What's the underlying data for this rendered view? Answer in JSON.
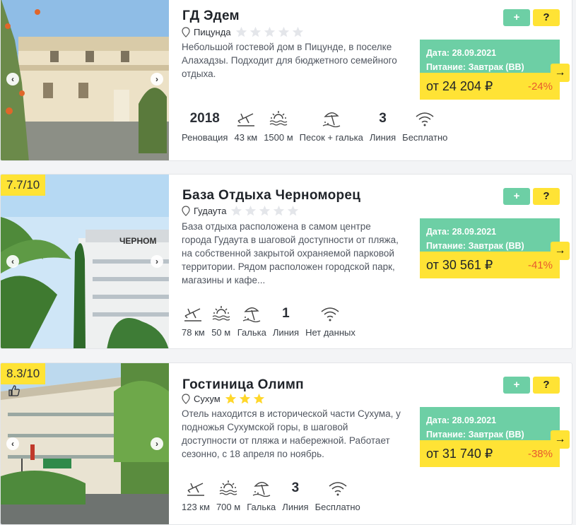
{
  "colors": {
    "accent_green": "#6dcfa5",
    "accent_yellow": "#ffe335",
    "discount": "#e85a2e",
    "star_filled": "#ffd72b",
    "star_empty": "#e4e6ea"
  },
  "ui": {
    "add_label": "+",
    "info_label": "?",
    "prev_label": "‹",
    "next_label": "›",
    "arrow_label": "→"
  },
  "hotels": [
    {
      "name": "ГД Эдем",
      "city": "Пицунда",
      "stars_filled": 0,
      "stars_total": 5,
      "rating": "",
      "description": "Небольшой гостевой дом в Пицунде, в поселке Алахадзы. Подходит для бюджетного семейного отдыха.",
      "date": "Дата: 28.09.2021",
      "meal": "Питание: Завтрак (BB)",
      "price": "от 24 204 ₽",
      "discount": "-24%",
      "features": [
        {
          "type": "text",
          "value": "2018",
          "label": "Реновация"
        },
        {
          "type": "icon",
          "icon": "airplane-icon",
          "label": "43 км"
        },
        {
          "type": "icon",
          "icon": "sea-icon",
          "label": "1500 м"
        },
        {
          "type": "icon",
          "icon": "beach-icon",
          "label": "Песок + галька"
        },
        {
          "type": "text",
          "value": "3",
          "label": "Линия"
        },
        {
          "type": "icon",
          "icon": "wifi-icon",
          "label": "Бесплатно"
        }
      ]
    },
    {
      "name": "База Отдыха Черноморец",
      "city": "Гудаута",
      "stars_filled": 0,
      "stars_total": 5,
      "rating": "7.7/10",
      "description": "База отдыха расположена в самом центре города Гудаута в шаговой доступности от пляжа, на собственной закрытой охраняемой парковой территории. Рядом расположен городской парк, магазины и кафе...",
      "date": "Дата: 28.09.2021",
      "meal": "Питание: Завтрак (BB)",
      "price": "от 30 561 ₽",
      "discount": "-41%",
      "features": [
        {
          "type": "icon",
          "icon": "airplane-icon",
          "label": "78 км"
        },
        {
          "type": "icon",
          "icon": "sea-icon",
          "label": "50 м"
        },
        {
          "type": "icon",
          "icon": "beach-icon",
          "label": "Галька"
        },
        {
          "type": "text",
          "value": "1",
          "label": "Линия"
        },
        {
          "type": "icon",
          "icon": "wifi-icon",
          "label": "Нет данных"
        }
      ]
    },
    {
      "name": "Гостиница Олимп",
      "city": "Сухум",
      "stars_filled": 3,
      "stars_total": 3,
      "rating": "8.3/10",
      "description": "Отель находится в исторической части Сухума, у подножья Сухумской горы, в шаговой доступности от пляжа и набережной. Работает сезонно, с 18 апреля по ноябрь.",
      "date": "Дата: 28.09.2021",
      "meal": "Питание: Завтрак (BB)",
      "price": "от 31 740 ₽",
      "discount": "-38%",
      "features": [
        {
          "type": "icon",
          "icon": "airplane-icon",
          "label": "123 км"
        },
        {
          "type": "icon",
          "icon": "sea-icon",
          "label": "700 м"
        },
        {
          "type": "icon",
          "icon": "beach-icon",
          "label": "Галька"
        },
        {
          "type": "text",
          "value": "3",
          "label": "Линия"
        },
        {
          "type": "icon",
          "icon": "wifi-icon",
          "label": "Бесплатно"
        }
      ]
    }
  ]
}
